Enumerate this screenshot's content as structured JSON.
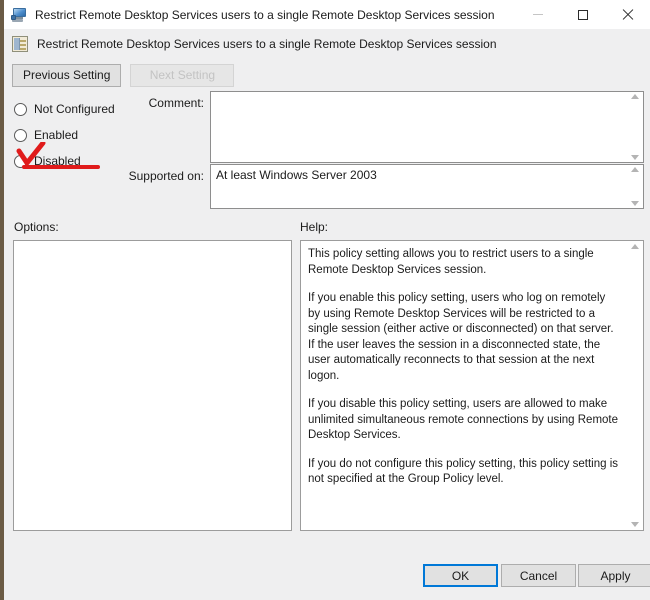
{
  "window": {
    "title": "Restrict Remote Desktop Services users to a single Remote Desktop Services session",
    "title_icon": "remote-desktop-monitor-icon",
    "controls": {
      "minimize": "minimize-icon",
      "maximize": "maximize-icon",
      "close": "close-icon"
    }
  },
  "header": {
    "icon": "policy-setting-icon",
    "title": "Restrict Remote Desktop Services users to a single Remote Desktop Services session"
  },
  "nav": {
    "previous_label": "Previous Setting",
    "next_label": "Next Setting"
  },
  "state": {
    "options": [
      {
        "id": "not-configured",
        "label": "Not Configured",
        "selected": false
      },
      {
        "id": "enabled",
        "label": "Enabled",
        "selected": false
      },
      {
        "id": "disabled",
        "label": "Disabled",
        "selected": false
      }
    ]
  },
  "annotation": {
    "type": "red-ink-markup",
    "color": "#e01b1b",
    "marks": [
      "checkmark-over-disabled-radio",
      "underline-below-disabled"
    ]
  },
  "comment": {
    "label": "Comment:",
    "value": "",
    "placeholder": ""
  },
  "supported": {
    "label": "Supported on:",
    "value": "At least Windows Server 2003"
  },
  "sections": {
    "options_label": "Options:",
    "help_label": "Help:"
  },
  "options_panel": {
    "content": ""
  },
  "help": {
    "paragraphs": [
      "This policy setting allows you to restrict users to a single Remote Desktop Services session.",
      "If you enable this policy setting, users who log on remotely by using Remote Desktop Services will be restricted to a single session (either active or disconnected) on that server. If the user leaves the session in a disconnected state, the user automatically reconnects to that session at the next logon.",
      "If you disable this policy setting, users are allowed to make unlimited simultaneous remote connections by using Remote Desktop Services.",
      "If you do not configure this policy setting,  this policy setting is not specified at the Group Policy level."
    ]
  },
  "footer": {
    "ok_label": "OK",
    "cancel_label": "Cancel",
    "apply_label": "Apply"
  },
  "colors": {
    "accent": "#0078d7",
    "annotation": "#e01b1b",
    "window_bg": "#efeff0",
    "desktop": "#6b5b45"
  }
}
